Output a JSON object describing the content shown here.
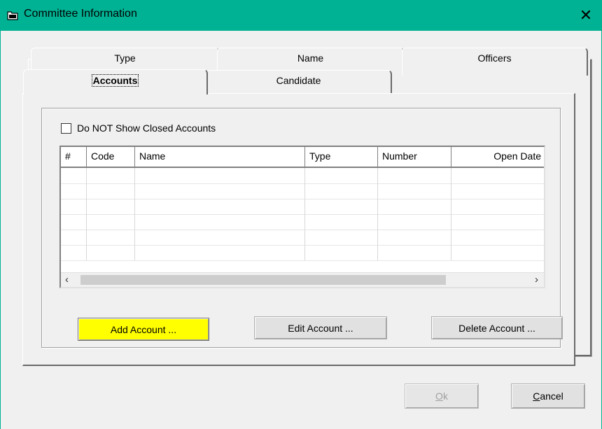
{
  "window": {
    "title": "Committee Information",
    "close_glyph": "✕",
    "accent_color": "#00b294"
  },
  "tabs": {
    "type_label": "Type",
    "name_label": "Name",
    "officers_label": "Officers",
    "accounts_label": "Accounts",
    "candidate_label": "Candidate",
    "active": "Accounts"
  },
  "accounts": {
    "hide_closed_label": "Do NOT Show Closed Accounts",
    "hide_closed_checked": false,
    "columns": [
      "#",
      "Code",
      "Name",
      "Type",
      "Number",
      "Open Date"
    ],
    "rows": [],
    "scroll_left_glyph": "‹",
    "scroll_right_glyph": "›",
    "add_label": "Add Account ...",
    "add_color": "#ffff00",
    "edit_label": "Edit Account ...",
    "delete_label": "Delete Account ..."
  },
  "dialog": {
    "ok_mnemonic": "O",
    "ok_rest": "k",
    "ok_enabled": false,
    "cancel_mnemonic": "C",
    "cancel_rest": "ancel"
  }
}
